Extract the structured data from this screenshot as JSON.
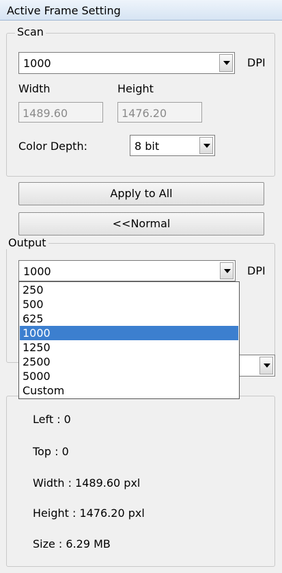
{
  "window": {
    "title": "Active Frame Setting"
  },
  "scan": {
    "legend": "Scan",
    "dpi_value": "1000",
    "dpi_unit": "DPI",
    "width_label": "Width",
    "height_label": "Height",
    "width_value": "1489.60",
    "height_value": "1476.20",
    "color_depth_label": "Color Depth:",
    "color_depth_value": "8 bit"
  },
  "buttons": {
    "apply_all": "Apply to All",
    "normal": "<<Normal"
  },
  "output": {
    "legend": "Output",
    "dpi_value": "1000",
    "dpi_unit": "DPI",
    "dropdown_options": [
      "250",
      "500",
      "625",
      "1000",
      "1250",
      "2500",
      "5000",
      "Custom"
    ],
    "selected_option": "1000"
  },
  "information": {
    "left": "Left : 0",
    "top": "Top : 0",
    "width": "Width : 1489.60 pxl",
    "height": "Height : 1476.20 pxl",
    "size": "Size : 6.29 MB"
  }
}
